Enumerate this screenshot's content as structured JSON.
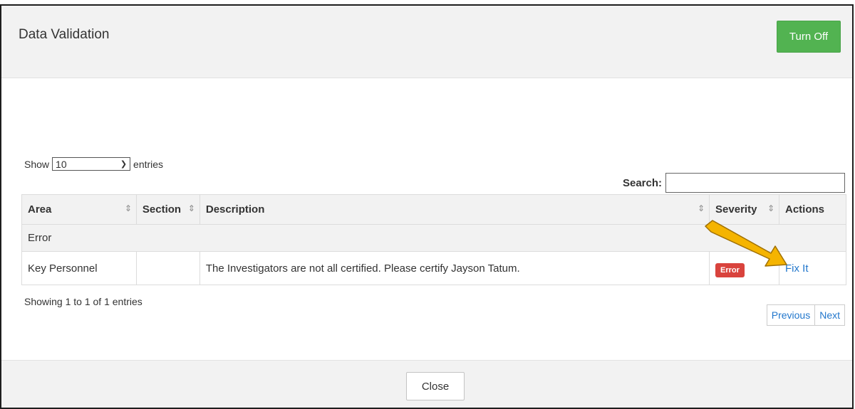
{
  "modal": {
    "title": "Data Validation",
    "turn_off_label": "Turn Off"
  },
  "length": {
    "show": "Show",
    "value": "10",
    "entries": "entries"
  },
  "search": {
    "label": "Search:",
    "value": ""
  },
  "table": {
    "headers": [
      "Area",
      "Section",
      "Description",
      "Severity",
      "Actions"
    ],
    "group": "Error",
    "rows": [
      {
        "area": "Key Personnel",
        "section": "",
        "description": "The Investigators are not all certified. Please certify Jayson Tatum.",
        "severity": "Error",
        "action": "Fix It"
      }
    ]
  },
  "info": "Showing 1 to 1 of 1 entries",
  "pager": {
    "previous": "Previous",
    "next": "Next"
  },
  "footer": {
    "close_label": "Close"
  },
  "colors": {
    "turn_off_bg": "#52b351",
    "error_badge": "#d9433d",
    "link": "#2277cc",
    "annotation_arrow": "#f5b400"
  }
}
